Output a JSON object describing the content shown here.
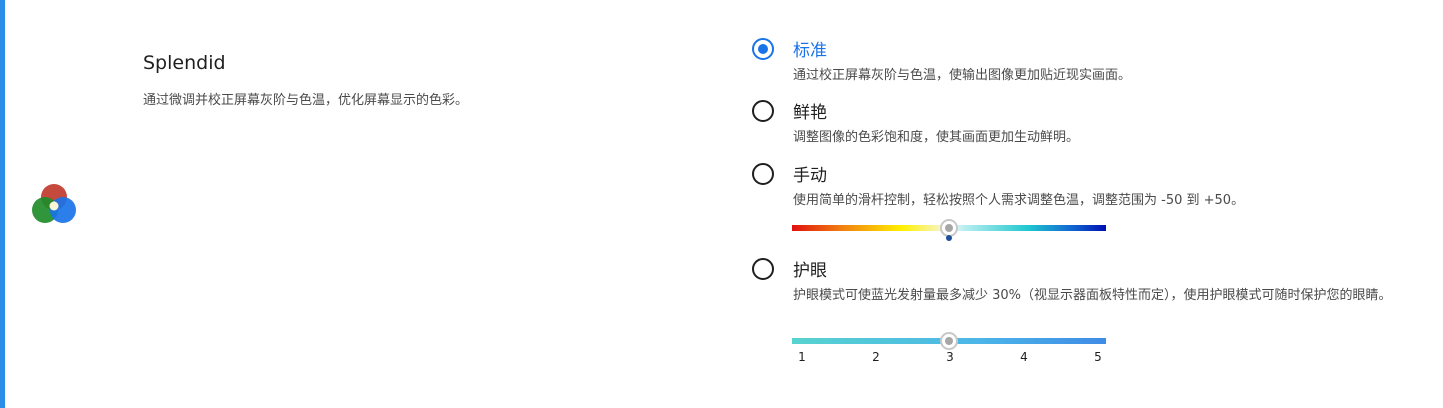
{
  "section": {
    "title": "Splendid",
    "description": "通过微调并校正屏幕灰阶与色温，优化屏幕显示的色彩。",
    "icon": "color-circles-icon"
  },
  "options": [
    {
      "id": "standard",
      "label": "标准",
      "description": "通过校正屏幕灰阶与色温，使输出图像更加贴近现实画面。",
      "selected": true
    },
    {
      "id": "vivid",
      "label": "鲜艳",
      "description": "调整图像的色彩饱和度，使其画面更加生动鲜明。",
      "selected": false
    },
    {
      "id": "manual",
      "label": "手动",
      "description": "使用简单的滑杆控制，轻松按照个人需求调整色温，调整范围为 -50 到 +50。",
      "selected": false
    },
    {
      "id": "eye-care",
      "label": "护眼",
      "description": "护眼模式可使蓝光发射量最多减少 30%（视显示器面板特性而定），使用护眼模式可随时保护您的眼睛。",
      "selected": false
    }
  ],
  "color_temp_slider": {
    "min": -50,
    "max": 50,
    "value": 0
  },
  "eye_care_slider": {
    "min": 1,
    "max": 5,
    "value": 3,
    "ticks": [
      "1",
      "2",
      "3",
      "4",
      "5"
    ]
  },
  "colors": {
    "accent": "#1a73e8",
    "side_bar": "#2b8fe8"
  }
}
